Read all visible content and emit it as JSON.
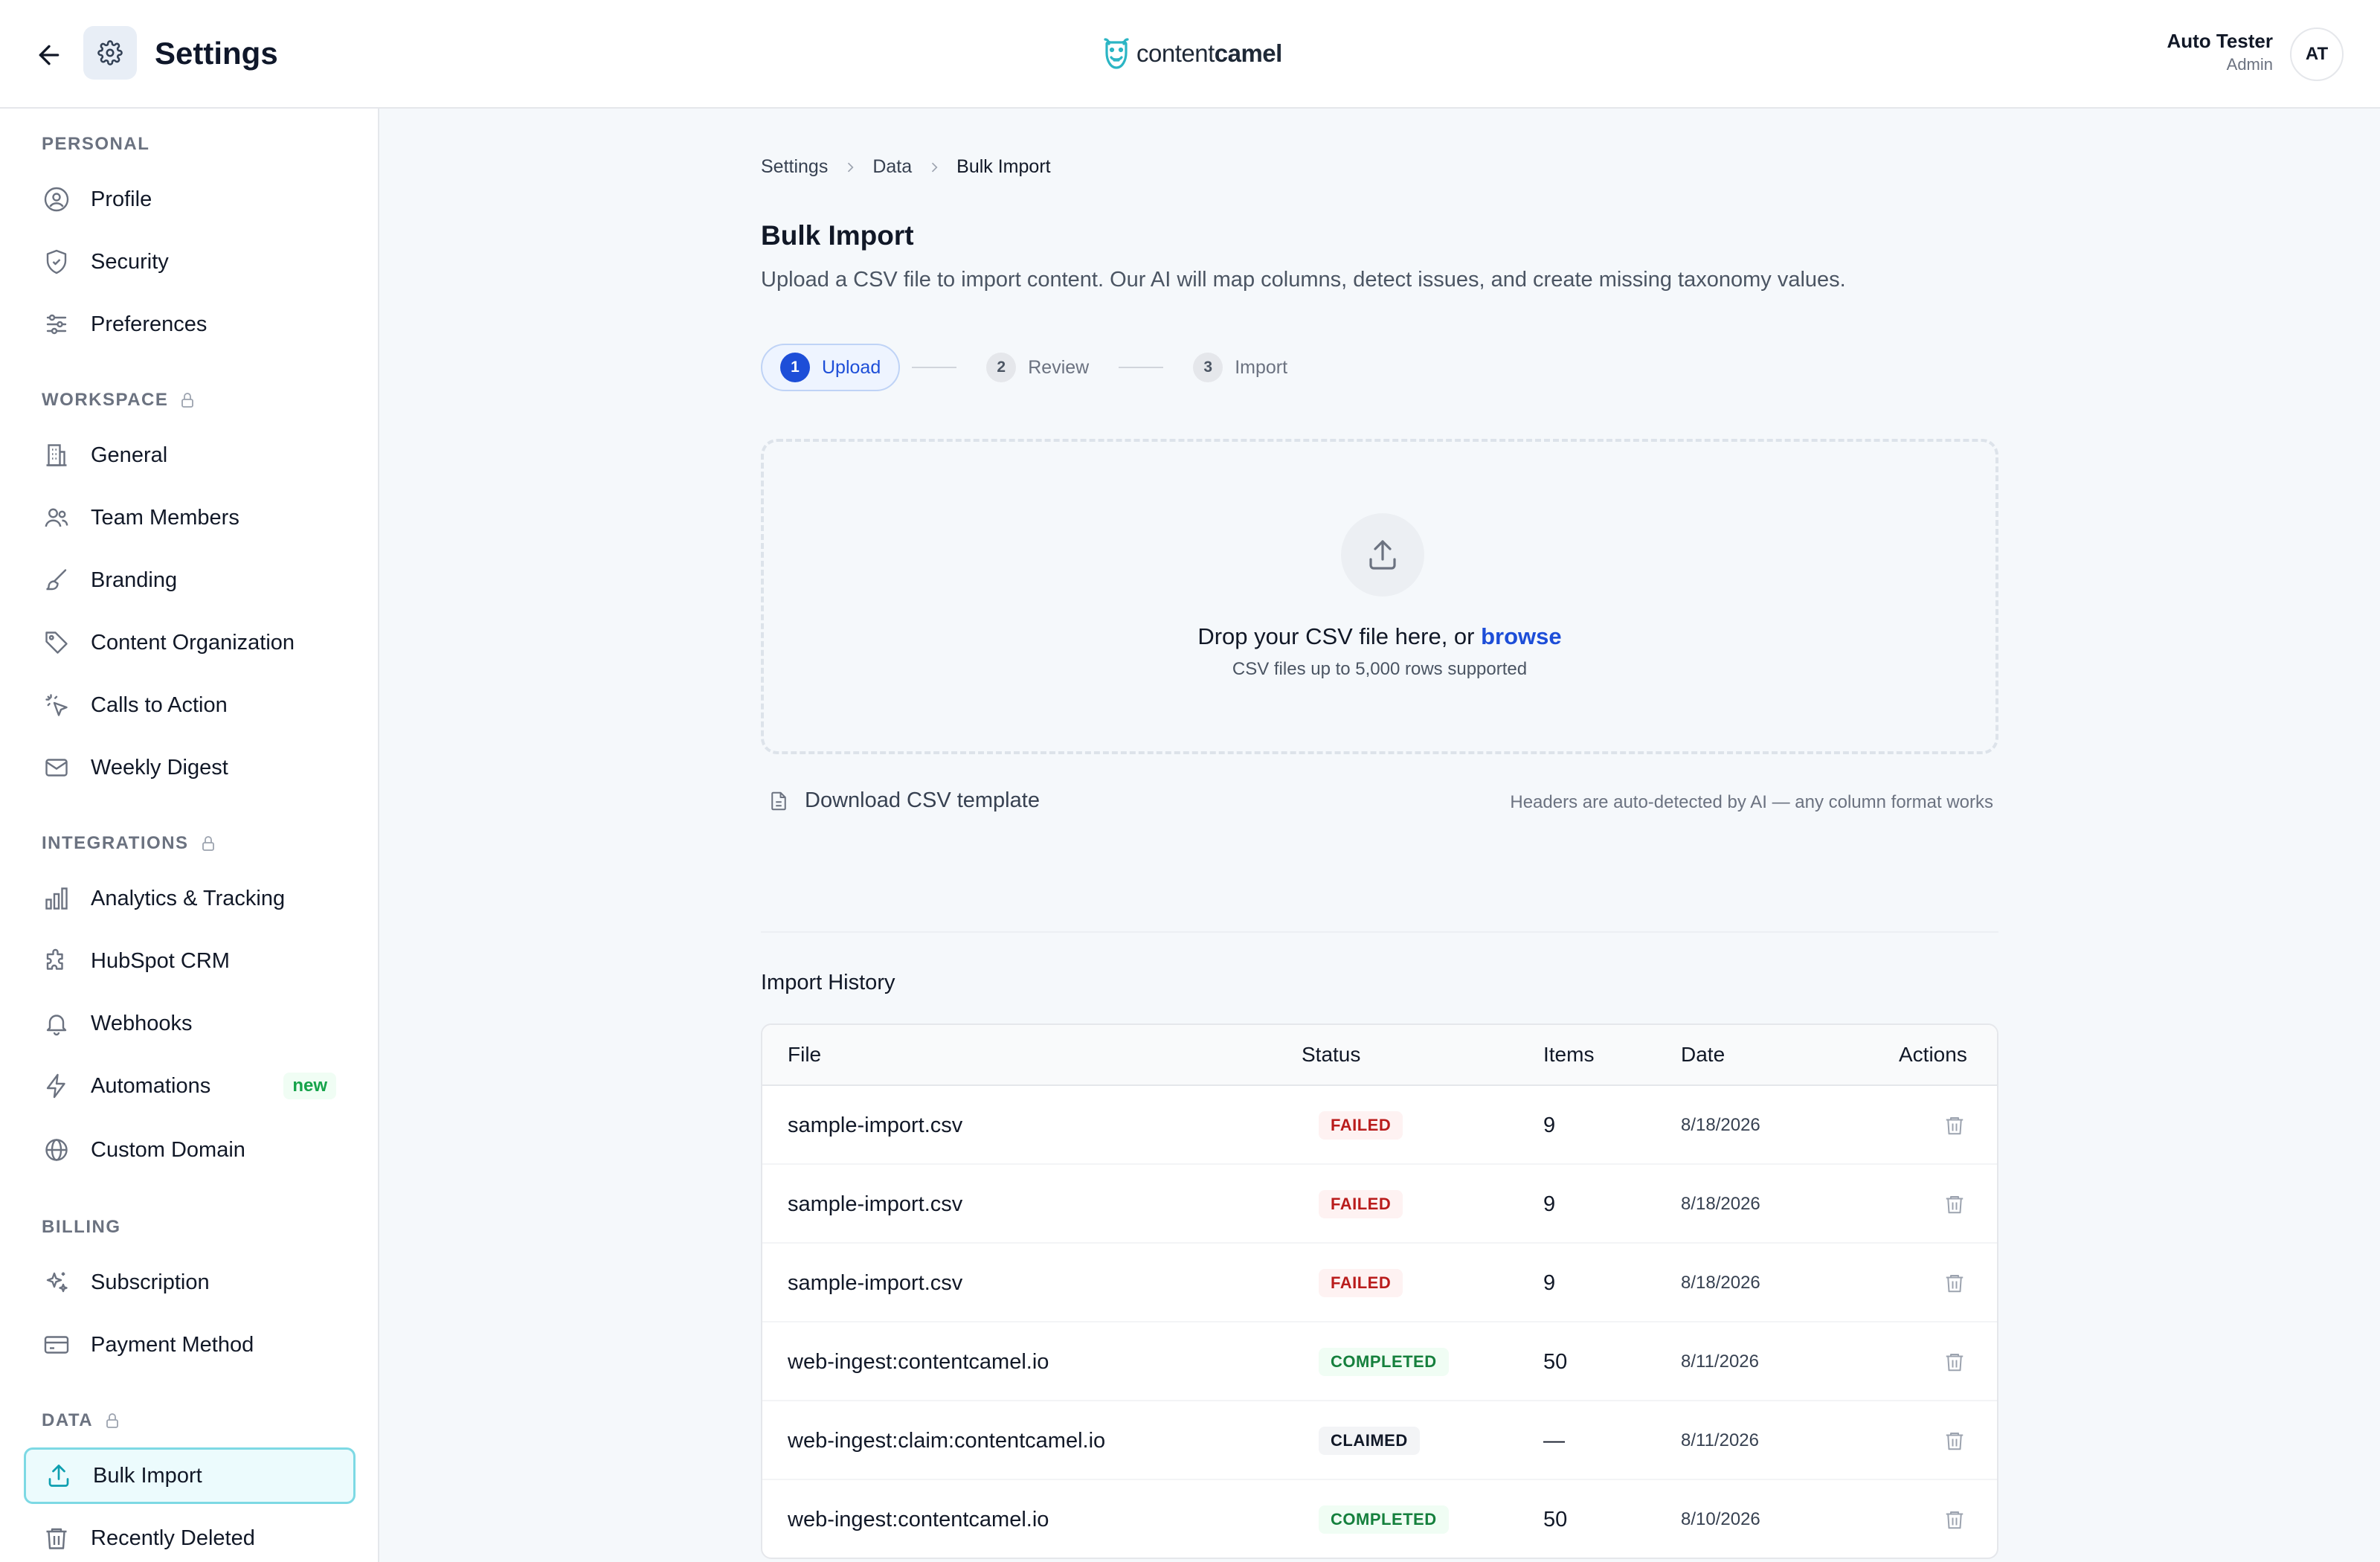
{
  "header": {
    "title": "Settings",
    "brand": {
      "prefix": "content",
      "suffix": "camel"
    },
    "user": {
      "name": "Auto Tester",
      "role": "Admin",
      "initials": "AT"
    }
  },
  "sidebar": {
    "sections": [
      {
        "label": "PERSONAL",
        "items": [
          {
            "label": "Profile",
            "icon": "user-circle-icon"
          },
          {
            "label": "Security",
            "icon": "shield-icon"
          },
          {
            "label": "Preferences",
            "icon": "sliders-icon"
          }
        ]
      },
      {
        "label": "WORKSPACE",
        "locked": true,
        "items": [
          {
            "label": "General",
            "icon": "building-icon"
          },
          {
            "label": "Team Members",
            "icon": "users-icon"
          },
          {
            "label": "Branding",
            "icon": "brush-icon"
          },
          {
            "label": "Content Organization",
            "icon": "tag-icon"
          },
          {
            "label": "Calls to Action",
            "icon": "pointer-click-icon"
          },
          {
            "label": "Weekly Digest",
            "icon": "mail-icon"
          }
        ]
      },
      {
        "label": "INTEGRATIONS",
        "locked": true,
        "items": [
          {
            "label": "Analytics & Tracking",
            "icon": "bar-chart-icon"
          },
          {
            "label": "HubSpot CRM",
            "icon": "puzzle-icon"
          },
          {
            "label": "Webhooks",
            "icon": "bell-icon"
          },
          {
            "label": "Automations",
            "icon": "zap-icon",
            "badge": "new"
          },
          {
            "label": "Custom Domain",
            "icon": "globe-icon"
          }
        ]
      },
      {
        "label": "BILLING",
        "items": [
          {
            "label": "Subscription",
            "icon": "sparkles-icon"
          },
          {
            "label": "Payment Method",
            "icon": "credit-card-icon"
          }
        ]
      },
      {
        "label": "DATA",
        "locked": true,
        "items": [
          {
            "label": "Bulk Import",
            "icon": "upload-icon",
            "active": true
          },
          {
            "label": "Recently Deleted",
            "icon": "trash-icon"
          }
        ]
      }
    ]
  },
  "breadcrumb": [
    "Settings",
    "Data",
    "Bulk Import"
  ],
  "page": {
    "title": "Bulk Import",
    "subtitle": "Upload a CSV file to import content. Our AI will map columns, detect issues, and create missing taxonomy values."
  },
  "steps": [
    {
      "num": "1",
      "label": "Upload",
      "active": true
    },
    {
      "num": "2",
      "label": "Review"
    },
    {
      "num": "3",
      "label": "Import"
    }
  ],
  "dropzone": {
    "text": "Drop your CSV file here, or",
    "browse": "browse",
    "hint": "CSV files up to 5,000 rows supported"
  },
  "template_link": "Download CSV template",
  "headers_note": "Headers are auto-detected by AI — any column format works",
  "history": {
    "title": "Import History",
    "columns": [
      "File",
      "Status",
      "Items",
      "Date",
      "Actions"
    ],
    "rows": [
      {
        "file": "sample-import.csv",
        "status": "FAILED",
        "items": "9",
        "date": "8/18/2026"
      },
      {
        "file": "sample-import.csv",
        "status": "FAILED",
        "items": "9",
        "date": "8/18/2026"
      },
      {
        "file": "sample-import.csv",
        "status": "FAILED",
        "items": "9",
        "date": "8/18/2026"
      },
      {
        "file": "web-ingest:contentcamel.io",
        "status": "COMPLETED",
        "items": "50",
        "date": "8/11/2026"
      },
      {
        "file": "web-ingest:claim:contentcamel.io",
        "status": "CLAIMED",
        "items": "—",
        "date": "8/11/2026"
      },
      {
        "file": "web-ingest:contentcamel.io",
        "status": "COMPLETED",
        "items": "50",
        "date": "8/10/2026"
      }
    ]
  },
  "colors": {
    "accent": "#1d4ed8",
    "brand": "#2bb5c4",
    "failed": "#b91c1c",
    "completed": "#15803d"
  }
}
